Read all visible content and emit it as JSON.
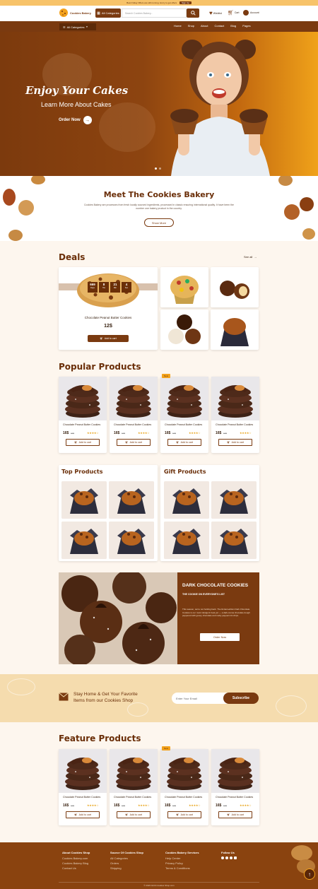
{
  "topbar": {
    "text": "Best Friday Offers are still running. Hurry to get offers",
    "cta": "Sign Up"
  },
  "header": {
    "logo": "Cookies Bakery",
    "categories_btn": "All Categories",
    "search_placeholder": "Search Cookies Bakery...",
    "wishlist": "Wishlist",
    "cart": "Cart",
    "account": "Account"
  },
  "nav": {
    "all_categories": "All Categories",
    "items": [
      "Home",
      "Shop",
      "About",
      "Contact",
      "Blog",
      "Pages"
    ]
  },
  "hero": {
    "title": "Enjoy Your Cakes",
    "subtitle": "Learn More About Cakes",
    "cta": "Order Now"
  },
  "about": {
    "title": "Meet The Cookies Bakery",
    "body": "Cookies Bakery are processes from fresh locally sourced ingredients, processed in classic ensuring international quality. It have been the number one bakery product in the country.",
    "cta": "Show More"
  },
  "deals": {
    "title": "Deals",
    "see_all": "See all",
    "countdown": [
      {
        "value": "669",
        "unit": "Days"
      },
      {
        "value": "8",
        "unit": "Hrs"
      },
      {
        "value": "21",
        "unit": "Min"
      },
      {
        "value": "4",
        "unit": "Sec"
      }
    ],
    "product_name": "Chocolate Peanut Butter Cookies",
    "price": "12$",
    "cta": "Add to cart"
  },
  "popular": {
    "title": "Popular Products",
    "badge": "New",
    "products": [
      {
        "name": "Chocolate Peanut Butter Cookies",
        "price": "16$",
        "old": "19$",
        "cta": "Add to cart"
      },
      {
        "name": "Chocolate Peanut Butter Cookies",
        "price": "16$",
        "old": "19$",
        "cta": "Add to cart"
      },
      {
        "name": "Chocolate Peanut Butter Cookies",
        "price": "16$",
        "old": "19$",
        "cta": "Add to cart"
      },
      {
        "name": "Chocolate Peanut Butter Cookies",
        "price": "16$",
        "old": "19$",
        "cta": "Add to cart"
      }
    ]
  },
  "top_products": {
    "title": "Top Products"
  },
  "gift_products": {
    "title": "Gift Products"
  },
  "promo": {
    "title": "DARK CHOCOLATE COOKIES",
    "subtitle": "THE COOKIE ON EVERYONE'S LIST",
    "body": "This season, we're not holding back. The limited-edition Dark Chocolate Cookies is our most indulgent treat yet — a dark-cocoa chocolate dough peppered with gooey chocolate and melty peppermint chips.",
    "cta": "Order Now"
  },
  "newsletter": {
    "text_line1": "Stay Home & Get Your Favorite",
    "text_line2": "Items from our Cookies Shop",
    "placeholder": "Enter Your Email",
    "cta": "Subscribe"
  },
  "feature": {
    "title": "Feature Products",
    "badge": "New",
    "products": [
      {
        "name": "Chocolate Peanut Butter Cookies",
        "price": "16$",
        "old": "19$",
        "cta": "Add to cart"
      },
      {
        "name": "Chocolate Peanut Butter Cookies",
        "price": "16$",
        "old": "19$",
        "cta": "Add to cart"
      },
      {
        "name": "Chocolate Peanut Butter Cookies",
        "price": "16$",
        "old": "19$",
        "cta": "Add to cart"
      },
      {
        "name": "Chocolate Peanut Butter Cookies",
        "price": "16$",
        "old": "19$",
        "cta": "Add to cart"
      }
    ]
  },
  "footer": {
    "col1": {
      "title": "About Cookies Shop",
      "links": [
        "Cookies Bakery.com",
        "Cookies Bakery Blog",
        "Contact Us"
      ]
    },
    "col2": {
      "title": "Source Of Cookies Shop",
      "links": [
        "All Categories",
        "Orders",
        "Shipping"
      ]
    },
    "col3": {
      "title": "Cookies Bakery Services",
      "links": [
        "Help Center",
        "Privacy Policy",
        "Terms & Conditions"
      ]
    },
    "col4": {
      "title": "Follow Us"
    },
    "copyright": "© 2023 GGS Cookies Shop.com"
  },
  "colors": {
    "brand": "#7a3a10",
    "accent": "#f3a21c",
    "cream": "#fdf6ee"
  }
}
